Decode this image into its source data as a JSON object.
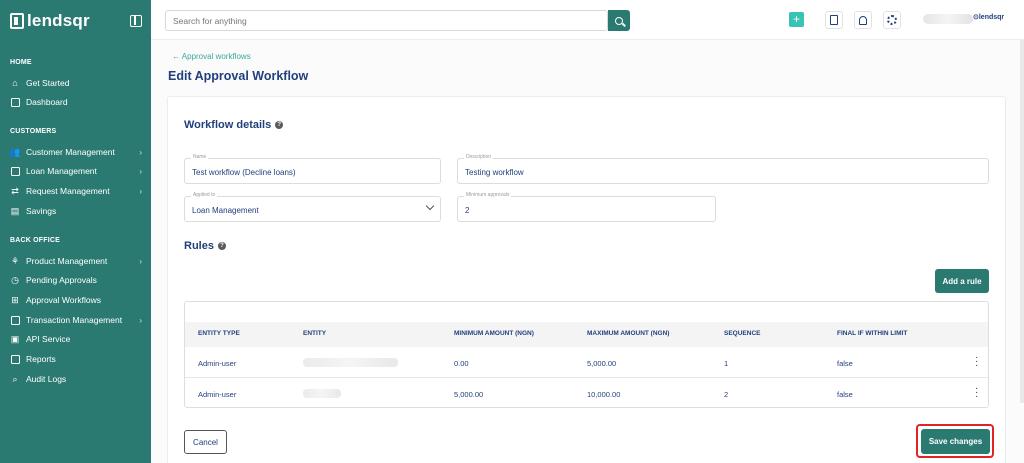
{
  "brand": {
    "name": "lendsqr"
  },
  "sidebar": {
    "sections": [
      {
        "title": "HOME"
      },
      {
        "title": "CUSTOMERS"
      },
      {
        "title": "BACK OFFICE"
      }
    ],
    "items": [
      {
        "label": "Get Started"
      },
      {
        "label": "Dashboard"
      },
      {
        "label": "Customer Management"
      },
      {
        "label": "Loan Management"
      },
      {
        "label": "Request Management"
      },
      {
        "label": "Savings"
      },
      {
        "label": "Product Management"
      },
      {
        "label": "Pending Approvals"
      },
      {
        "label": "Approval Workflows"
      },
      {
        "label": "Transaction Management"
      },
      {
        "label": "API Service"
      },
      {
        "label": "Reports"
      },
      {
        "label": "Audit Logs"
      }
    ]
  },
  "topbar": {
    "search_placeholder": "Search for anything",
    "org_logo": "⊙lendsqr"
  },
  "main": {
    "back_link": "← Approval workflows",
    "title": "Edit Approval Workflow",
    "details_heading": "Workflow details",
    "fields": {
      "name": {
        "label": "Name",
        "value": "Test workflow (Decline loans)"
      },
      "description": {
        "label": "Description",
        "value": "Testing workflow"
      },
      "applied_to": {
        "label": "Applied to",
        "value": "Loan Management"
      },
      "min_approvals": {
        "label": "Minimum approvals",
        "value": "2"
      }
    },
    "rules_heading": "Rules",
    "add_rule": "Add a rule",
    "table": {
      "headers": [
        "ENTITY TYPE",
        "ENTITY",
        "MINIMUM AMOUNT (NGN)",
        "MAXIMUM AMOUNT (NGN)",
        "SEQUENCE",
        "FINAL IF WITHIN LIMIT"
      ],
      "rows": [
        {
          "entity_type": "Admin-user",
          "min": "0.00",
          "max": "5,000.00",
          "sequence": "1",
          "final": "false"
        },
        {
          "entity_type": "Admin-user",
          "min": "5,000.00",
          "max": "10,000.00",
          "sequence": "2",
          "final": "false"
        }
      ]
    },
    "cancel": "Cancel",
    "save": "Save changes"
  },
  "colors": {
    "primary": "#2b7a72",
    "accent": "#39c3b4",
    "text": "#213f7d",
    "highlight": "#e02424"
  },
  "icons": {
    "search": "search-icon",
    "plus": "plus-icon",
    "doc": "document-icon",
    "bell": "bell-icon",
    "gear": "gear-icon",
    "help": "help-icon",
    "kebab": "kebab-icon"
  }
}
